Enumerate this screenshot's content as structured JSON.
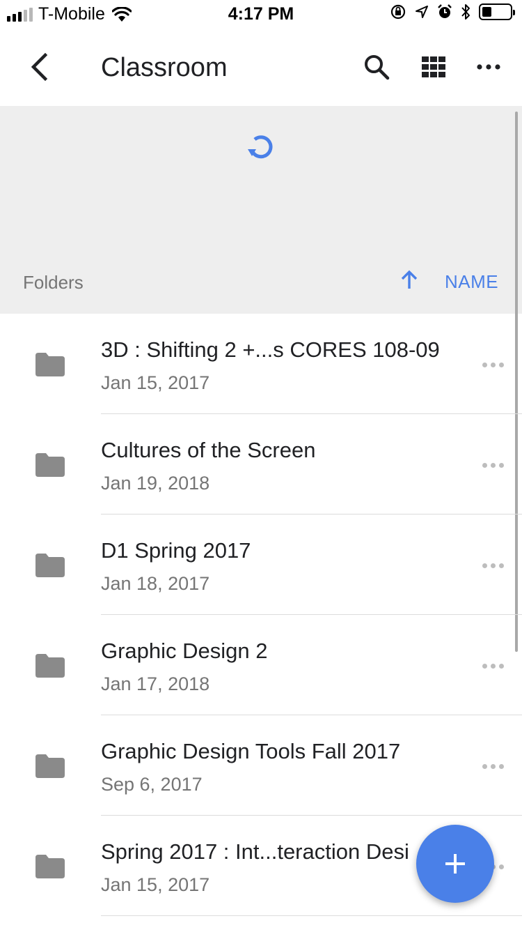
{
  "status_bar": {
    "carrier": "T-Mobile",
    "time": "4:17 PM",
    "signal_bars_filled": 3,
    "signal_bars_total": 5,
    "battery_level": 0.35
  },
  "app_bar": {
    "title": "Classroom",
    "icons": [
      "back-icon",
      "search-icon",
      "grid-view-icon",
      "more-icon"
    ]
  },
  "sort_header": {
    "section_label": "Folders",
    "sort_label": "NAME",
    "sort_direction": "ascending"
  },
  "folders": [
    {
      "name": "3D : Shifting 2 +...s CORES 108-09",
      "date": "Jan 15, 2017"
    },
    {
      "name": "Cultures of the Screen",
      "date": "Jan 19, 2018"
    },
    {
      "name": "D1 Spring 2017",
      "date": "Jan 18, 2017"
    },
    {
      "name": "Graphic Design 2",
      "date": "Jan 17, 2018"
    },
    {
      "name": "Graphic Design Tools Fall 2017",
      "date": "Sep 6, 2017"
    },
    {
      "name": "Spring 2017 : Int...teraction Desi",
      "date": "Jan 15, 2017"
    }
  ],
  "colors": {
    "accent": "#4a80e8",
    "refresh_bg": "#eeeeee",
    "icon_grey": "#8a8a8a",
    "text_primary": "#202124",
    "text_secondary": "#757575"
  }
}
